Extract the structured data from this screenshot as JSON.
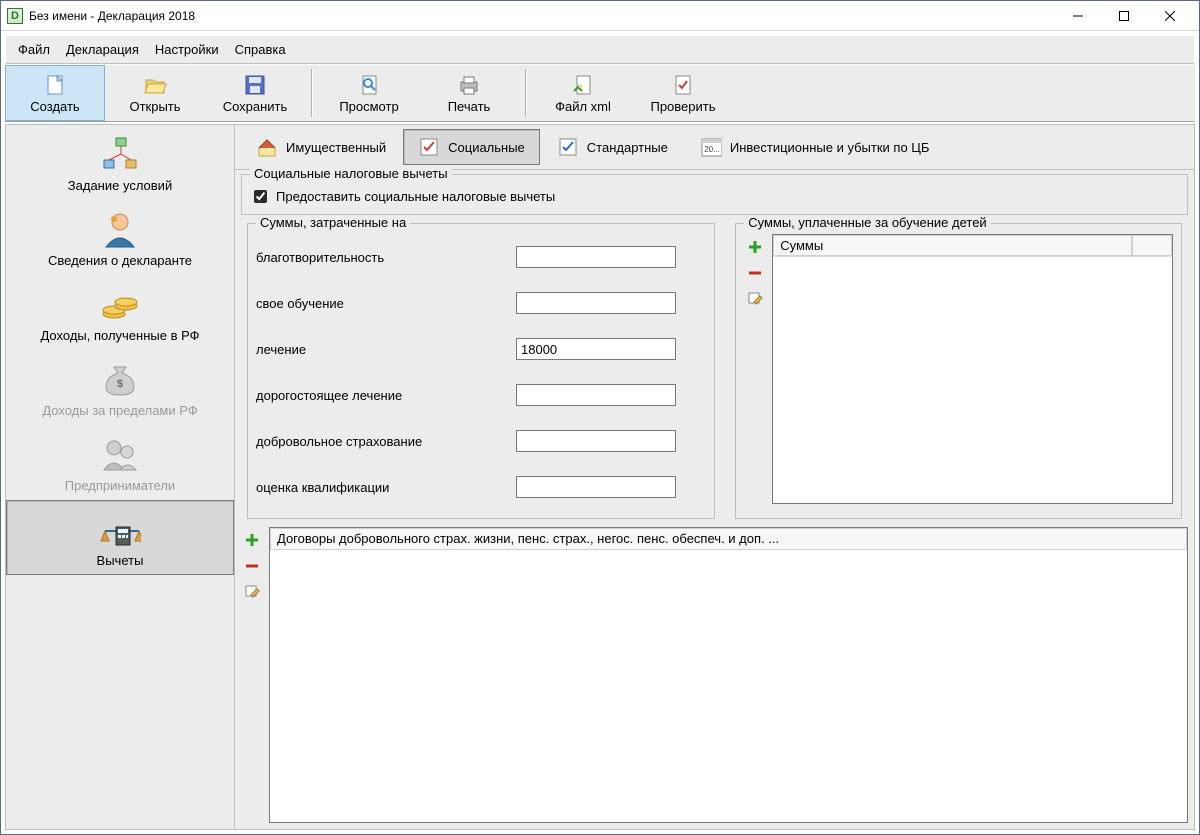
{
  "window": {
    "title": "Без имени - Декларация 2018"
  },
  "menu": {
    "file": "Файл",
    "declaration": "Декларация",
    "settings": "Настройки",
    "help": "Справка"
  },
  "toolbar": {
    "create": "Создать",
    "open": "Открыть",
    "save": "Сохранить",
    "preview": "Просмотр",
    "print": "Печать",
    "filexml": "Файл xml",
    "check": "Проверить"
  },
  "sidebar": {
    "conditions": "Задание условий",
    "declarant": "Сведения о декларанте",
    "income_rf": "Доходы, полученные в РФ",
    "income_abroad": "Доходы за пределами РФ",
    "entrepreneurs": "Предприниматели",
    "deductions": "Вычеты"
  },
  "tabs": {
    "property": "Имущественный",
    "social": "Социальные",
    "standard": "Стандартные",
    "invest": "Инвестиционные и убытки по ЦБ"
  },
  "social_group": {
    "legend": "Социальные налоговые вычеты",
    "provide_label": "Предоставить социальные налоговые вычеты",
    "provide_checked": true
  },
  "spent_group": {
    "legend": "Суммы, затраченные на",
    "fields": {
      "charity": {
        "label": "благотворительность",
        "value": ""
      },
      "own_edu": {
        "label": "свое обучение",
        "value": ""
      },
      "treatment": {
        "label": "лечение",
        "value": "18000"
      },
      "expensive_treatment": {
        "label": "дорогостоящее лечение",
        "value": ""
      },
      "voluntary_insurance": {
        "label": "добровольное страхование",
        "value": ""
      },
      "qualification": {
        "label": "оценка квалификации",
        "value": ""
      }
    }
  },
  "children_edu": {
    "legend": "Суммы, уплаченные за обучение детей",
    "column": "Суммы"
  },
  "contracts": {
    "header": "Договоры добровольного страх. жизни, пенс. страх., негос. пенс. обеспеч. и доп. ..."
  },
  "icons": {
    "calendar_badge": "20..."
  }
}
